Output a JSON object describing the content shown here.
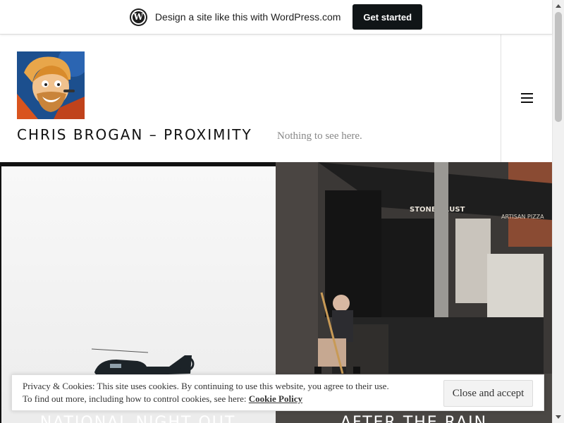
{
  "wpbar": {
    "logo_icon": "wordpress-logo-icon",
    "text": "Design a site like this with WordPress.com",
    "cta_label": "Get started"
  },
  "header": {
    "site_title": "CHRIS BROGAN – PROXIMITY",
    "tagline": "Nothing to see here.",
    "menu_icon": "hamburger-menu-icon"
  },
  "posts": [
    {
      "title": "NATIONAL NIGHT OUT"
    },
    {
      "title": "AFTER THE RAIN"
    }
  ],
  "cookie_banner": {
    "line1": "Privacy & Cookies: This site uses cookies. By continuing to use this website, you agree to their use.",
    "line2_prefix": "To find out more, including how to control cookies, see here: ",
    "policy_link": "Cookie Policy",
    "accept_label": "Close and accept"
  },
  "colors": {
    "accent_dark": "#101517",
    "text": "#111111",
    "muted": "#888888"
  }
}
